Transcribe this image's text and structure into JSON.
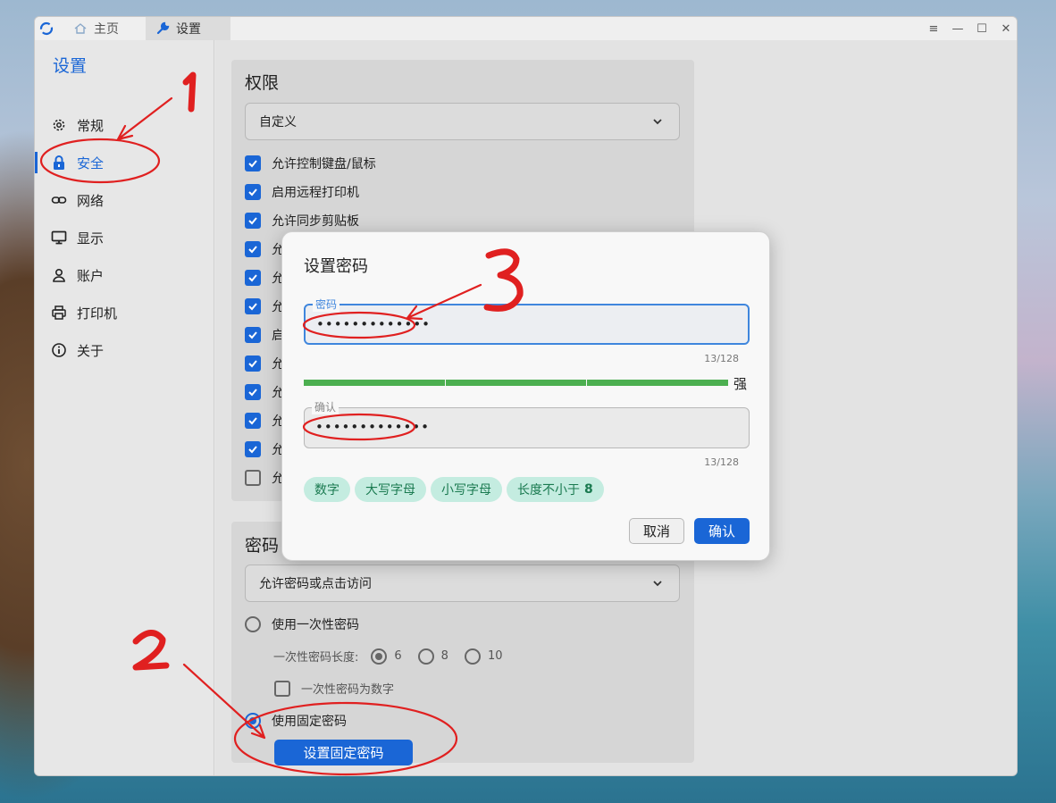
{
  "titlebar": {
    "tabs": [
      {
        "label": "主页",
        "icon": "home-icon"
      },
      {
        "label": "设置",
        "icon": "wrench-icon"
      }
    ],
    "controls": [
      "menu-icon",
      "minimize-icon",
      "maximize-icon",
      "close-icon"
    ]
  },
  "sidebar": {
    "title": "设置",
    "items": [
      {
        "label": "常规",
        "icon": "gear-icon"
      },
      {
        "label": "安全",
        "icon": "lock-icon",
        "active": true
      },
      {
        "label": "网络",
        "icon": "link-icon"
      },
      {
        "label": "显示",
        "icon": "monitor-icon"
      },
      {
        "label": "账户",
        "icon": "user-icon"
      },
      {
        "label": "打印机",
        "icon": "printer-icon"
      },
      {
        "label": "关于",
        "icon": "info-icon"
      }
    ]
  },
  "permissions": {
    "title": "权限",
    "select_value": "自定义",
    "checkboxes": [
      {
        "label": "允许控制键盘/鼠标",
        "checked": true
      },
      {
        "label": "启用远程打印机",
        "checked": true
      },
      {
        "label": "允许同步剪贴板",
        "checked": true
      },
      {
        "label": "允",
        "checked": true
      },
      {
        "label": "允",
        "checked": true
      },
      {
        "label": "允",
        "checked": true
      },
      {
        "label": "启",
        "checked": true
      },
      {
        "label": "允",
        "checked": true
      },
      {
        "label": "允",
        "checked": true
      },
      {
        "label": "允",
        "checked": true
      },
      {
        "label": "允",
        "checked": true
      },
      {
        "label": "允",
        "checked": false
      }
    ]
  },
  "password": {
    "title": "密码",
    "select_value": "允许密码或点击访问",
    "one_time_label": "使用一次性密码",
    "length_label": "一次性密码长度:",
    "length_options": [
      "6",
      "8",
      "10"
    ],
    "length_selected": "6",
    "numeric_label": "一次性密码为数字",
    "fixed_label": "使用固定密码",
    "set_fixed_button": "设置固定密码"
  },
  "dialog": {
    "title": "设置密码",
    "password_label": "密码",
    "password_value": "•••••••••••••",
    "password_counter": "13/128",
    "strength_label": "强",
    "strength_level": 1.0,
    "confirm_label": "确认",
    "confirm_value": "•••••••••••••",
    "confirm_counter": "13/128",
    "chips": [
      {
        "label": "数字",
        "extra": ""
      },
      {
        "label": "大写字母",
        "extra": ""
      },
      {
        "label": "小写字母",
        "extra": ""
      },
      {
        "label": "长度不小于",
        "extra": "8"
      }
    ],
    "cancel": "取消",
    "ok": "确认"
  },
  "annotations": [
    "1",
    "2",
    "3"
  ],
  "colors": {
    "accent": "#1a66d6",
    "strength": "#4caf50",
    "annotation": "#e02020",
    "chip_bg": "#c4ece0"
  }
}
